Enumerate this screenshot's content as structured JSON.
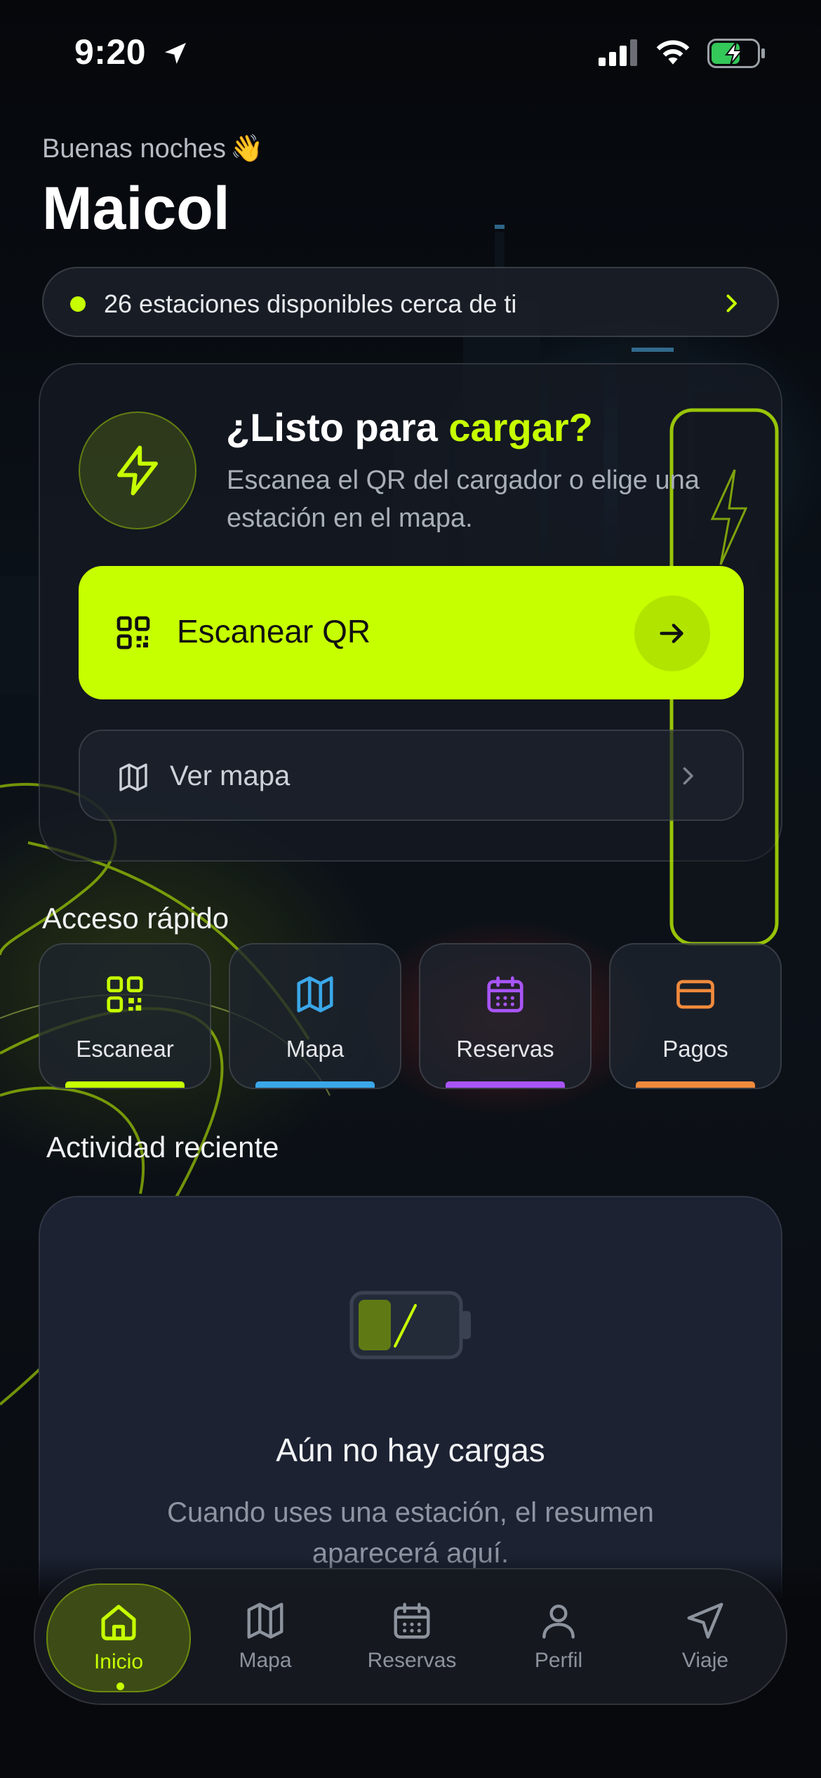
{
  "status_bar": {
    "time": "9:20"
  },
  "greeting": {
    "text": "Buenas noches",
    "emoji": "👋",
    "name": "Maicol"
  },
  "stations_pill": {
    "text": "26 estaciones disponibles cerca de ti"
  },
  "hero": {
    "title_prefix": "¿Listo para ",
    "title_accent": "cargar?",
    "subtitle": "Escanea el QR del cargador o elige una estación en el mapa.",
    "scan_button": "Escanear QR",
    "map_button": "Ver mapa"
  },
  "quick_access": {
    "title": "Acceso rápido",
    "items": [
      {
        "label": "Escanear",
        "icon": "qr-icon",
        "color": "#c6ff00"
      },
      {
        "label": "Mapa",
        "icon": "map-icon",
        "color": "#3aa7e8"
      },
      {
        "label": "Reservas",
        "icon": "calendar-icon",
        "color": "#a855f7"
      },
      {
        "label": "Pagos",
        "icon": "card-icon",
        "color": "#f08a3c"
      }
    ]
  },
  "recent": {
    "title": "Actividad reciente",
    "empty_title": "Aún no hay cargas",
    "empty_subtitle": "Cuando uses una estación, el resumen aparecerá aquí."
  },
  "tab_bar": {
    "items": [
      {
        "label": "Inicio",
        "icon": "home-icon",
        "active": true
      },
      {
        "label": "Mapa",
        "icon": "map-icon",
        "active": false
      },
      {
        "label": "Reservas",
        "icon": "calendar-icon",
        "active": false
      },
      {
        "label": "Perfil",
        "icon": "user-icon",
        "active": false
      },
      {
        "label": "Viaje",
        "icon": "navigation-icon",
        "active": false
      }
    ]
  },
  "colors": {
    "accent": "#c6ff00",
    "background": "#07090d",
    "card": "#1c2232"
  }
}
